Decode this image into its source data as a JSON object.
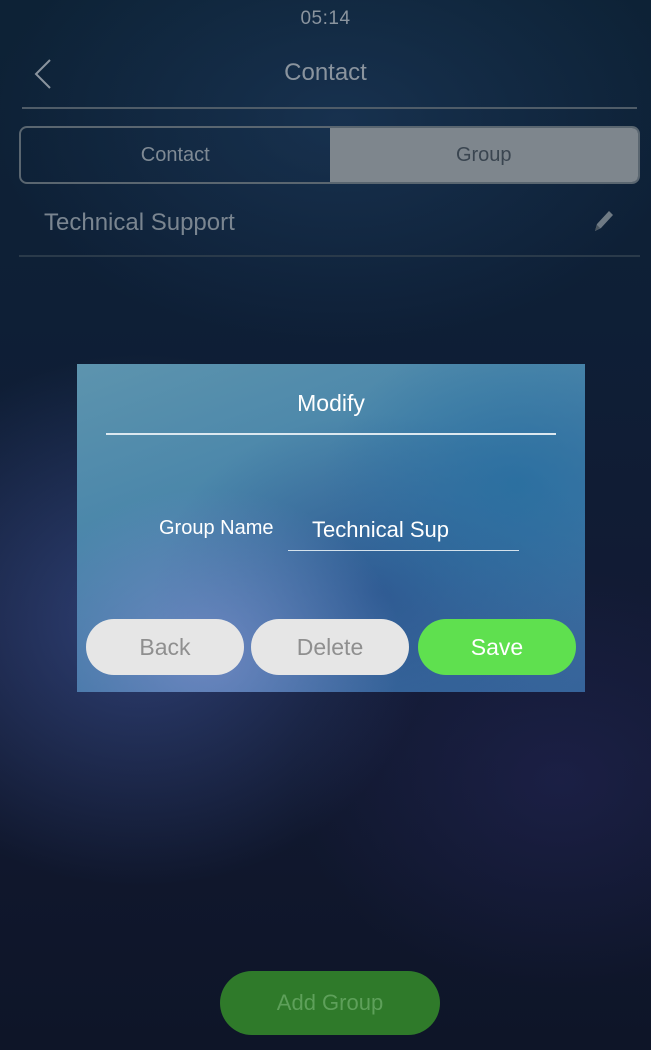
{
  "status_bar": {
    "time": "05:14"
  },
  "header": {
    "title": "Contact",
    "back_icon": "chevron-left-icon"
  },
  "tabs": [
    {
      "label": "Contact",
      "active": false
    },
    {
      "label": "Group",
      "active": true
    }
  ],
  "group_list": [
    {
      "name": "Technical Support",
      "edit_icon": "pencil-icon"
    }
  ],
  "modal": {
    "title": "Modify",
    "field_label": "Group Name",
    "field_value": "Technical Sup",
    "buttons": {
      "back": "Back",
      "delete": "Delete",
      "save": "Save"
    }
  },
  "footer": {
    "add_group_label": "Add Group"
  },
  "colors": {
    "save_button": "#5fe04f",
    "add_group_button": "#2f7a2a",
    "modal_background": "#4a86aa"
  }
}
